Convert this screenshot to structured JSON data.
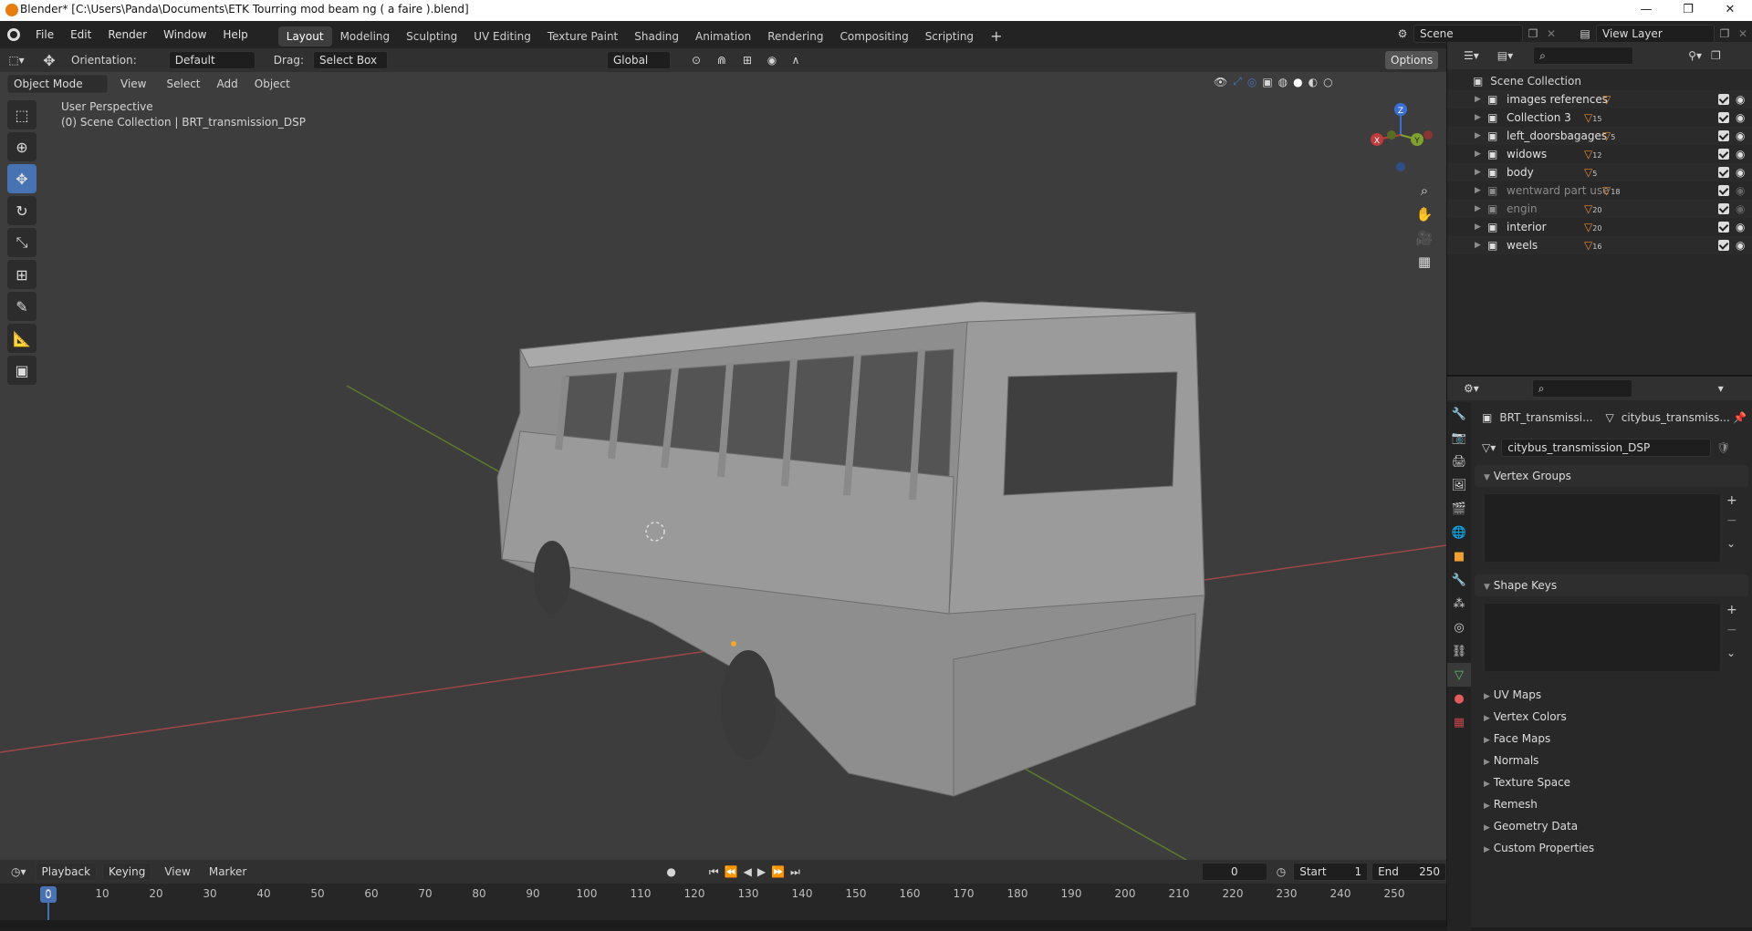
{
  "window": {
    "title": "Blender* [C:\\Users\\Panda\\Documents\\ETK Tourring mod beam ng ( a faire ).blend]",
    "minimize": "—",
    "maximize": "❐",
    "close": "✕"
  },
  "menus": [
    "File",
    "Edit",
    "Render",
    "Window",
    "Help"
  ],
  "workspaces": [
    "Layout",
    "Modeling",
    "Sculpting",
    "UV Editing",
    "Texture Paint",
    "Shading",
    "Animation",
    "Rendering",
    "Compositing",
    "Scripting"
  ],
  "active_workspace": "Layout",
  "scene": {
    "name": "Scene",
    "view_layer": "View Layer"
  },
  "tool_header": {
    "orientation_label": "Orientation:",
    "orientation_value": "Default",
    "drag_label": "Drag:",
    "drag_value": "Select Box",
    "transform_orientation": "Global",
    "options": "Options"
  },
  "viewport_header": {
    "mode": "Object Mode",
    "menus": [
      "View",
      "Select",
      "Add",
      "Object"
    ]
  },
  "viewport": {
    "perspective": "User Perspective",
    "collection_info": "(0) Scene Collection | BRT_transmission_DSP"
  },
  "gizmo": {
    "z": "Z",
    "y": "Y",
    "x": "X"
  },
  "outliner": {
    "root": "Scene Collection",
    "items": [
      {
        "name": "images references",
        "count": "",
        "dim": false
      },
      {
        "name": "Collection 3",
        "count": "15",
        "dim": false
      },
      {
        "name": "left_doorsbagages",
        "count": "5",
        "dim": false
      },
      {
        "name": "widows",
        "count": "12",
        "dim": false
      },
      {
        "name": "body",
        "count": "5",
        "dim": false
      },
      {
        "name": "wentward part use",
        "count": "18",
        "dim": true
      },
      {
        "name": "engin",
        "count": "20",
        "dim": true
      },
      {
        "name": "interior",
        "count": "20",
        "dim": false
      },
      {
        "name": "weels",
        "count": "16",
        "dim": false
      }
    ]
  },
  "properties": {
    "object_name": "BRT_transmissi...",
    "mesh_name": "citybus_transmiss...",
    "mesh_field": "citybus_transmission_DSP",
    "open_panels": [
      "Vertex Groups",
      "Shape Keys"
    ],
    "closed_panels": [
      "UV Maps",
      "Vertex Colors",
      "Face Maps",
      "Normals",
      "Texture Space",
      "Remesh",
      "Geometry Data",
      "Custom Properties"
    ]
  },
  "timeline": {
    "menus": [
      "Playback",
      "Keying",
      "View",
      "Marker"
    ],
    "current_frame": "0",
    "start_label": "Start",
    "start": "1",
    "end_label": "End",
    "end": "250",
    "ticks": [
      "0",
      "10",
      "20",
      "30",
      "40",
      "50",
      "60",
      "70",
      "80",
      "90",
      "100",
      "110",
      "120",
      "130",
      "140",
      "150",
      "160",
      "170",
      "180",
      "190",
      "200",
      "210",
      "220",
      "230",
      "240",
      "250"
    ]
  },
  "colors": {
    "accent": "#4772b3",
    "active_frame": "#4772b3",
    "axis_x": "#c03b3b",
    "axis_y": "#7fa22e",
    "axis_z": "#3b6fd8"
  }
}
